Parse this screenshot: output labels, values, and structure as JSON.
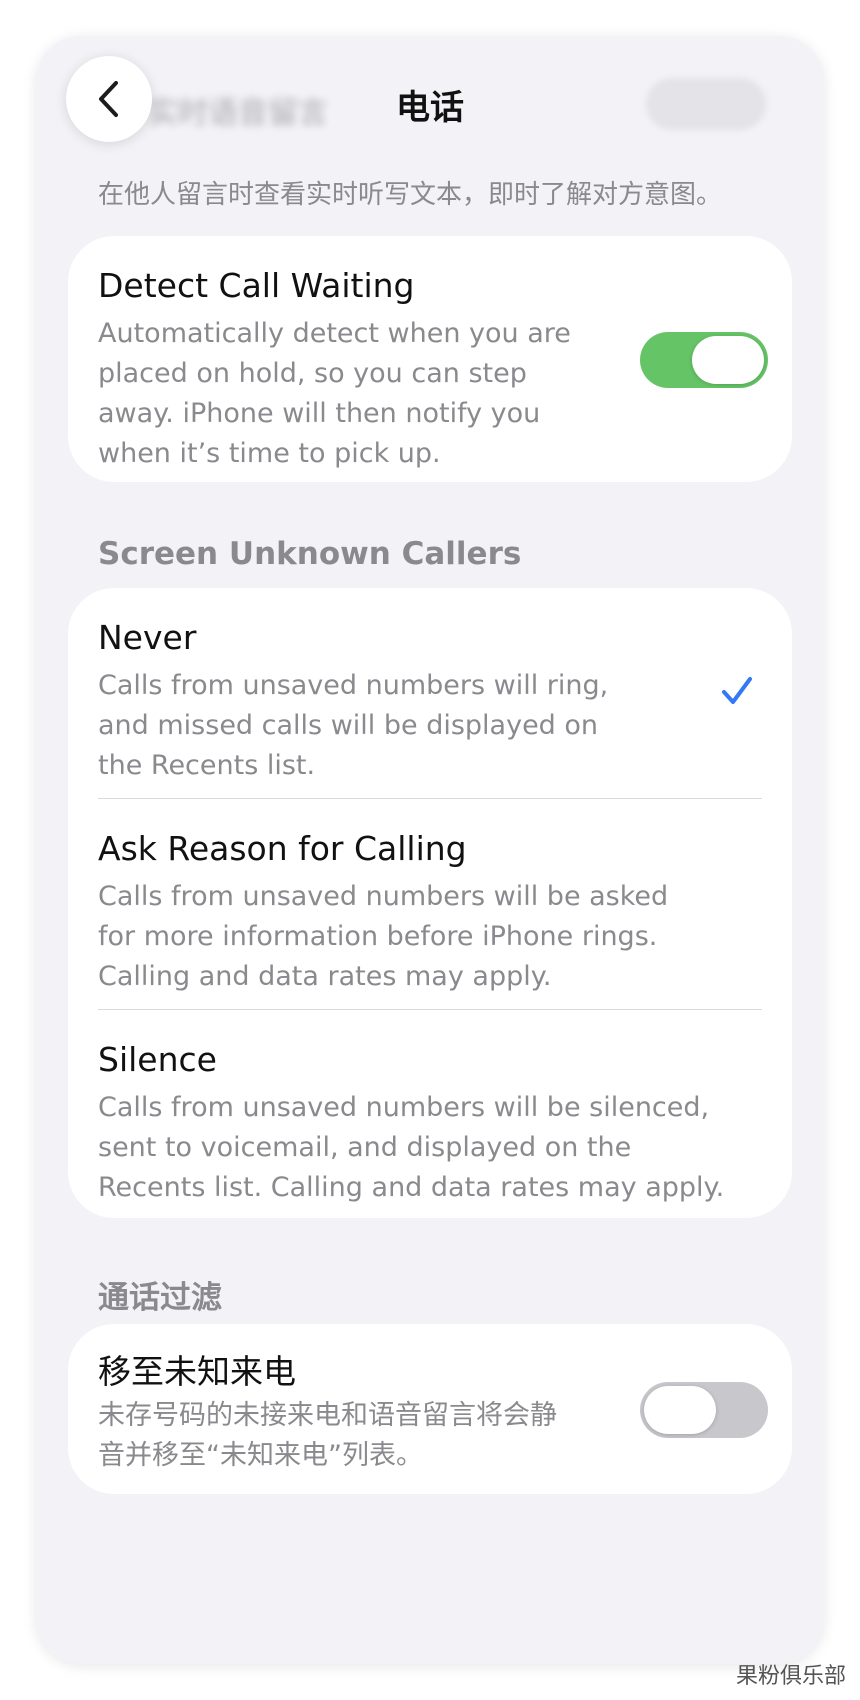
{
  "nav": {
    "title": "电话",
    "back_label_blurred": "实时语音留言"
  },
  "top_footnote": "在他人留言时查看实时听写文本，即时了解对方意图。",
  "detect_call_waiting": {
    "title": "Detect Call Waiting",
    "description": "Automatically detect when you are placed on hold, so you can step away. iPhone will then notify you when it’s time to pick up.",
    "toggle_on": true
  },
  "screen_unknown": {
    "header": "Screen Unknown Callers",
    "options": [
      {
        "title": "Never",
        "description": "Calls from unsaved numbers will ring, and missed calls will be displayed on the Recents list.",
        "selected": true
      },
      {
        "title": "Ask Reason for Calling",
        "description": "Calls from unsaved numbers will be asked for more information before iPhone rings. Calling and data rates may apply.",
        "selected": false
      },
      {
        "title": "Silence",
        "description": "Calls from unsaved numbers will be silenced, sent to voicemail, and displayed on the Recents list. Calling and data rates may apply.",
        "selected": false
      }
    ]
  },
  "call_filtering": {
    "header": "通话过滤",
    "title": "移至未知来电",
    "description": "未存号码的未接来电和语音留言将会静音并移至“未知来电”列表。",
    "toggle_on": false
  },
  "watermark": "果粉俱乐部",
  "colors": {
    "accent_blue": "#3478f6",
    "toggle_green": "#65c466",
    "toggle_off": "#c7c7cc",
    "background": "#f2f2f7"
  },
  "icons": {
    "back": "chevron-left-icon",
    "check": "checkmark-icon"
  }
}
